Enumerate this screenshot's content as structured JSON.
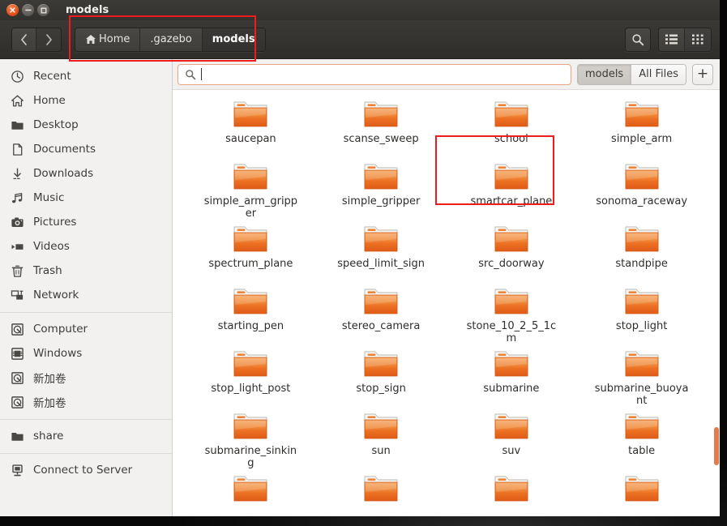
{
  "window": {
    "title": "models",
    "controls": {
      "close": "close-window",
      "minimize": "minimize-window",
      "maximize": "maximize-window"
    }
  },
  "toolbar": {
    "back_label": "‹",
    "forward_label": "›",
    "breadcrumb": [
      {
        "label": "Home",
        "icon": "home-icon",
        "active": false
      },
      {
        "label": ".gazebo",
        "icon": "",
        "active": false
      },
      {
        "label": "models",
        "icon": "",
        "active": true
      }
    ],
    "search_button": "search-icon",
    "view_list_button": "list-view-icon",
    "view_grid_button": "grid-view-icon"
  },
  "sidebar": {
    "items": [
      {
        "label": "Recent",
        "icon": "clock-icon",
        "type": "item"
      },
      {
        "label": "Home",
        "icon": "home-icon",
        "type": "item"
      },
      {
        "label": "Desktop",
        "icon": "folder-icon",
        "type": "item"
      },
      {
        "label": "Documents",
        "icon": "document-icon",
        "type": "item"
      },
      {
        "label": "Downloads",
        "icon": "download-icon",
        "type": "item"
      },
      {
        "label": "Music",
        "icon": "music-icon",
        "type": "item"
      },
      {
        "label": "Pictures",
        "icon": "camera-icon",
        "type": "item"
      },
      {
        "label": "Videos",
        "icon": "video-icon",
        "type": "item"
      },
      {
        "label": "Trash",
        "icon": "trash-icon",
        "type": "item"
      },
      {
        "label": "Network",
        "icon": "network-icon",
        "type": "item"
      },
      {
        "label": "",
        "icon": "",
        "type": "separator"
      },
      {
        "label": "Computer",
        "icon": "disk-icon",
        "type": "item"
      },
      {
        "label": "Windows",
        "icon": "drive-icon",
        "type": "item"
      },
      {
        "label": "新加卷",
        "icon": "disk-icon",
        "type": "item"
      },
      {
        "label": "新加卷",
        "icon": "disk-icon",
        "type": "item"
      },
      {
        "label": "",
        "icon": "",
        "type": "separator"
      },
      {
        "label": "share",
        "icon": "folder-icon",
        "type": "item"
      },
      {
        "label": "",
        "icon": "",
        "type": "separator"
      },
      {
        "label": "Connect to Server",
        "icon": "server-icon",
        "type": "item"
      }
    ]
  },
  "search": {
    "value": "",
    "placeholder": "",
    "icon": "search-icon",
    "filters": [
      {
        "label": "models",
        "selected": true
      },
      {
        "label": "All Files",
        "selected": false
      }
    ],
    "add_button": "+"
  },
  "files": [
    {
      "name": "saucepan",
      "icon": "folder-icon",
      "highlighted": false
    },
    {
      "name": "scanse_sweep",
      "icon": "folder-icon",
      "highlighted": false
    },
    {
      "name": "school",
      "icon": "folder-icon",
      "highlighted": false
    },
    {
      "name": "simple_arm",
      "icon": "folder-icon",
      "highlighted": false
    },
    {
      "name": "simple_arm_gripper",
      "icon": "folder-icon",
      "highlighted": false
    },
    {
      "name": "simple_gripper",
      "icon": "folder-icon",
      "highlighted": false
    },
    {
      "name": "smartcar_plane",
      "icon": "folder-icon",
      "highlighted": true
    },
    {
      "name": "sonoma_raceway",
      "icon": "folder-icon",
      "highlighted": false
    },
    {
      "name": "spectrum_plane",
      "icon": "folder-icon",
      "highlighted": false
    },
    {
      "name": "speed_limit_sign",
      "icon": "folder-icon",
      "highlighted": false
    },
    {
      "name": "src_doorway",
      "icon": "folder-icon",
      "highlighted": false
    },
    {
      "name": "standpipe",
      "icon": "folder-icon",
      "highlighted": false
    },
    {
      "name": "starting_pen",
      "icon": "folder-icon",
      "highlighted": false
    },
    {
      "name": "stereo_camera",
      "icon": "folder-icon",
      "highlighted": false
    },
    {
      "name": "stone_10_2_5_1cm",
      "icon": "folder-icon",
      "highlighted": false
    },
    {
      "name": "stop_light",
      "icon": "folder-icon",
      "highlighted": false
    },
    {
      "name": "stop_light_post",
      "icon": "folder-icon",
      "highlighted": false
    },
    {
      "name": "stop_sign",
      "icon": "folder-icon",
      "highlighted": false
    },
    {
      "name": "submarine",
      "icon": "folder-icon",
      "highlighted": false
    },
    {
      "name": "submarine_buoyant",
      "icon": "folder-icon",
      "highlighted": false
    },
    {
      "name": "submarine_sinking",
      "icon": "folder-icon",
      "highlighted": false
    },
    {
      "name": "sun",
      "icon": "folder-icon",
      "highlighted": false
    },
    {
      "name": "suv",
      "icon": "folder-icon",
      "highlighted": false
    },
    {
      "name": "table",
      "icon": "folder-icon",
      "highlighted": false
    },
    {
      "name": "",
      "icon": "folder-icon",
      "highlighted": false
    },
    {
      "name": "",
      "icon": "folder-icon",
      "highlighted": false
    },
    {
      "name": "",
      "icon": "folder-icon",
      "highlighted": false
    },
    {
      "name": "",
      "icon": "folder-icon",
      "highlighted": false
    }
  ],
  "scrollbar": {
    "thumb_top_pct": 79,
    "thumb_height_pct": 9
  },
  "annotations": [
    {
      "name": "breadcrumb-highlight",
      "color": "#ee1c1c"
    },
    {
      "name": "smartcar-plane-highlight",
      "color": "#ee1c1c"
    }
  ],
  "colors": {
    "accent_orange": "#dd4814",
    "folder_orange": "#e8702a",
    "annotation_red": "#ee1c1c",
    "sidebar_bg": "#f2f1f0",
    "toolbar_bg": "#35332f"
  }
}
